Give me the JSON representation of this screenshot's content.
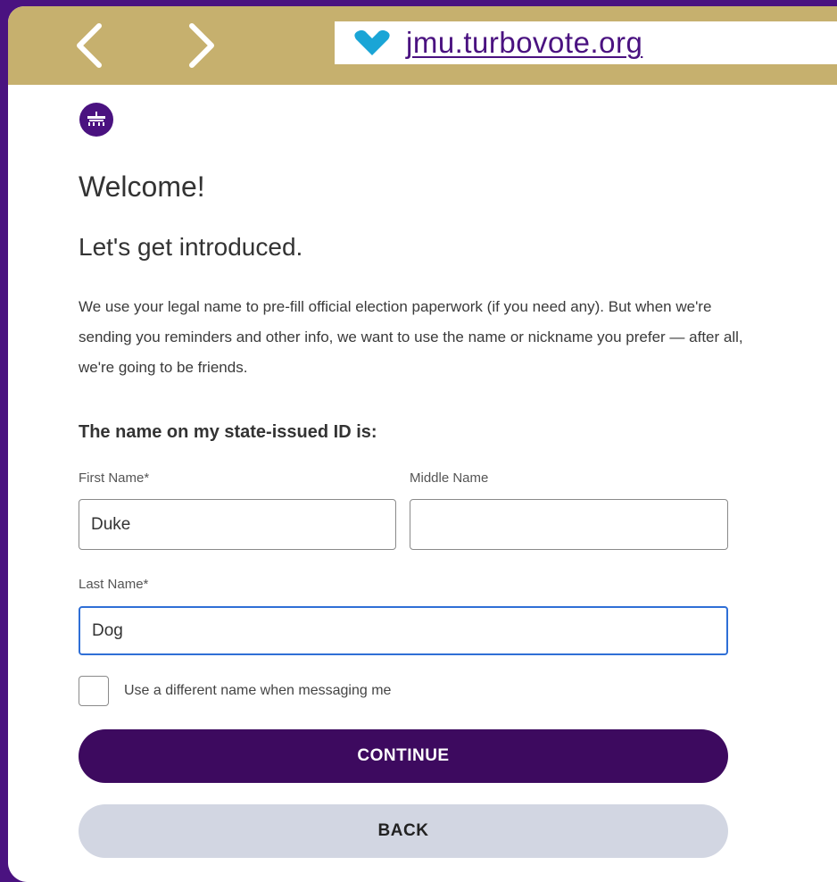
{
  "browser": {
    "url": "jmu.turbovote.org",
    "accent_color": "#c6b06e",
    "brand_color": "#4a1280",
    "back_icon": "chevron-left-icon",
    "forward_icon": "chevron-right-icon",
    "site_icon": "turbovote-heart-icon"
  },
  "page": {
    "logo_icon": "jmu-logo-icon",
    "welcome": "Welcome!",
    "subheading": "Let's get introduced.",
    "intro_text": "We use your legal name to pre-fill official election paperwork (if you need any). But when we're sending you reminders and other info, we want to use the name or nickname you prefer — after all, we're going to be friends.",
    "section_label": "The name on my state-issued ID is:"
  },
  "form": {
    "first_name": {
      "label": "First Name*",
      "value": "Duke"
    },
    "middle_name": {
      "label": "Middle Name",
      "value": ""
    },
    "last_name": {
      "label": "Last Name*",
      "value": "Dog"
    },
    "different_name": {
      "label": "Use a different name when messaging me",
      "checked": false
    },
    "continue_label": "CONTINUE",
    "back_label": "BACK",
    "continue_color": "#3d0a5f",
    "back_color": "#d2d6e2"
  }
}
